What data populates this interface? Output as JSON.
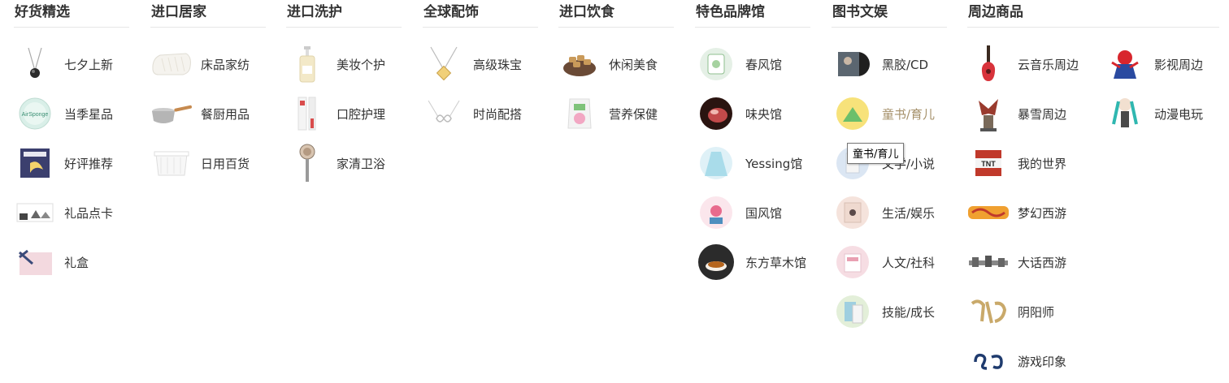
{
  "columns": [
    {
      "title": "好货精选",
      "items": [
        {
          "label": "七夕上新",
          "icon": "necklace-icon"
        },
        {
          "label": "当季星品",
          "icon": "airsponge-icon"
        },
        {
          "label": "好评推荐",
          "icon": "book-box-icon"
        },
        {
          "label": "礼品点卡",
          "icon": "gift-card-icon"
        },
        {
          "label": "礼盒",
          "icon": "gift-box-icon"
        }
      ]
    },
    {
      "title": "进口居家",
      "items": [
        {
          "label": "床品家纺",
          "icon": "pillow-icon"
        },
        {
          "label": "餐厨用品",
          "icon": "saucepan-icon"
        },
        {
          "label": "日用百货",
          "icon": "storage-box-icon"
        }
      ]
    },
    {
      "title": "进口洗护",
      "items": [
        {
          "label": "美妆个护",
          "icon": "pump-bottle-icon"
        },
        {
          "label": "口腔护理",
          "icon": "toothpaste-icon"
        },
        {
          "label": "家清卫浴",
          "icon": "shower-head-icon"
        }
      ]
    },
    {
      "title": "全球配饰",
      "items": [
        {
          "label": "高级珠宝",
          "icon": "pendant-icon"
        },
        {
          "label": "时尚配搭",
          "icon": "infinity-necklace-icon"
        }
      ]
    },
    {
      "title": "进口饮食",
      "items": [
        {
          "label": "休闲美食",
          "icon": "snack-bowl-icon"
        },
        {
          "label": "营养保健",
          "icon": "supplement-bag-icon"
        }
      ]
    },
    {
      "title": "特色品牌馆",
      "items": [
        {
          "label": "春风馆",
          "icon": "spring-brand-icon"
        },
        {
          "label": "味央馆",
          "icon": "meat-icon"
        },
        {
          "label": "Yessing馆",
          "icon": "dress-icon"
        },
        {
          "label": "国风馆",
          "icon": "flower-icon"
        },
        {
          "label": "东方草木馆",
          "icon": "tea-cup-icon"
        }
      ]
    },
    {
      "title": "图书文娱",
      "items": [
        {
          "label": "黑胶/CD",
          "icon": "vinyl-record-icon"
        },
        {
          "label": "童书/育儿",
          "icon": "children-book-icon",
          "hover": true
        },
        {
          "label": "文学/小说",
          "icon": "novel-icon"
        },
        {
          "label": "生活/娱乐",
          "icon": "lifestyle-book-icon"
        },
        {
          "label": "人文/社科",
          "icon": "humanities-book-icon"
        },
        {
          "label": "技能/成长",
          "icon": "skills-book-icon"
        }
      ]
    },
    {
      "title": "周边商品",
      "items": [
        {
          "label": "云音乐周边",
          "icon": "ukulele-icon"
        },
        {
          "label": "影视周边",
          "icon": "spiderman-figure-icon"
        },
        {
          "label": "暴雪周边",
          "icon": "dragon-figure-icon"
        },
        {
          "label": "动漫电玩",
          "icon": "anime-figure-icon"
        },
        {
          "label": "我的世界",
          "icon": "tnt-icon"
        },
        {
          "label": "梦幻西游",
          "icon": "fantasy-westward-logo-icon"
        },
        {
          "label": "大话西游",
          "icon": "westward-journey-logo-icon"
        },
        {
          "label": "阴阳师",
          "icon": "onmyoji-logo-icon"
        },
        {
          "label": "游戏印象",
          "icon": "game-impression-logo-icon"
        }
      ]
    }
  ],
  "tooltip": "童书/育儿",
  "colors": {
    "hover_label": "#a5906a",
    "divider": "#e6e6e6"
  }
}
